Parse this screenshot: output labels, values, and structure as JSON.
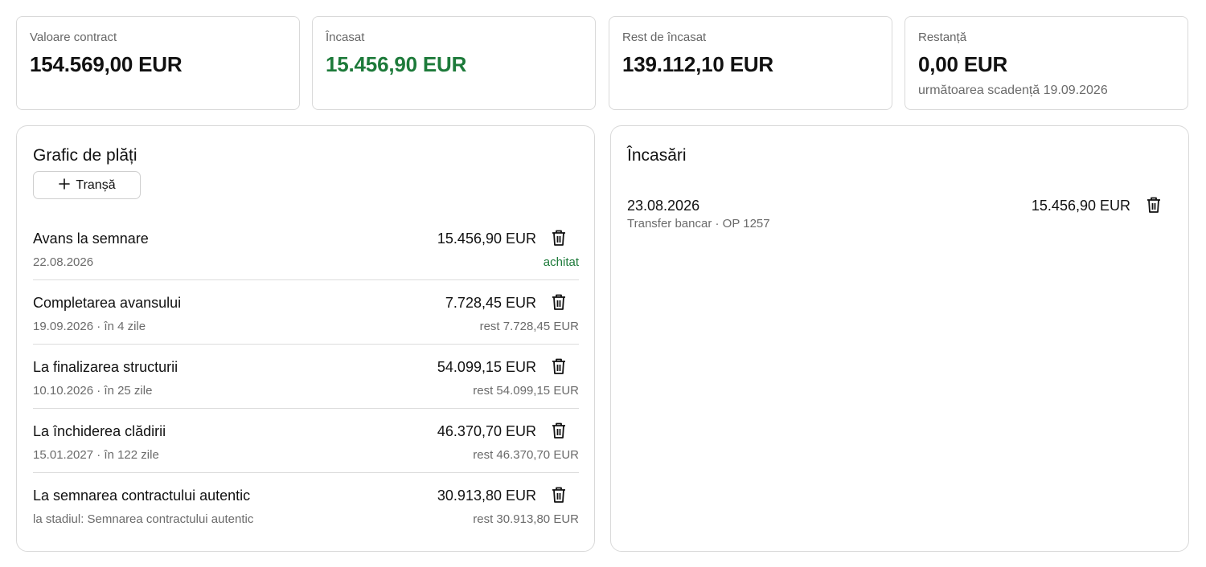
{
  "summary": {
    "contract_value": {
      "label": "Valoare contract",
      "value": "154.569,00 EUR"
    },
    "collected": {
      "label": "Încasat",
      "value": "15.456,90 EUR"
    },
    "remaining": {
      "label": "Rest de încasat",
      "value": "139.112,10 EUR"
    },
    "overdue": {
      "label": "Restanță",
      "value": "0,00 EUR",
      "note": "următoarea scadență 19.09.2026"
    }
  },
  "schedule": {
    "title": "Grafic de plăți",
    "add_label": "Tranșă",
    "items": [
      {
        "name": "Avans la semnare",
        "amount": "15.456,90 EUR",
        "date": "22.08.2026",
        "status": "achitat"
      },
      {
        "name": "Completarea avansului",
        "amount": "7.728,45 EUR",
        "date": "19.09.2026 · în 4 zile",
        "status": "rest 7.728,45 EUR"
      },
      {
        "name": "La finalizarea structurii",
        "amount": "54.099,15 EUR",
        "date": "10.10.2026 · în 25 zile",
        "status": "rest 54.099,15 EUR"
      },
      {
        "name": "La închiderea clădirii",
        "amount": "46.370,70 EUR",
        "date": "15.01.2027 · în 122 zile",
        "status": "rest 46.370,70 EUR"
      },
      {
        "name": "La semnarea contractului autentic",
        "amount": "30.913,80 EUR",
        "date": "la stadiul: Semnarea contractului autentic",
        "status": "rest 30.913,80 EUR"
      }
    ]
  },
  "payments": {
    "title": "Încasări",
    "items": [
      {
        "date": "23.08.2026",
        "description": "Transfer bancar · OP 1257",
        "amount": "15.456,90 EUR"
      }
    ]
  },
  "colors": {
    "paid_green": "#1d7a3a",
    "border": "#d9d9d9",
    "muted_text": "#6b6b6b"
  },
  "icons": {
    "delete": "trash-icon",
    "add": "plus-icon"
  }
}
